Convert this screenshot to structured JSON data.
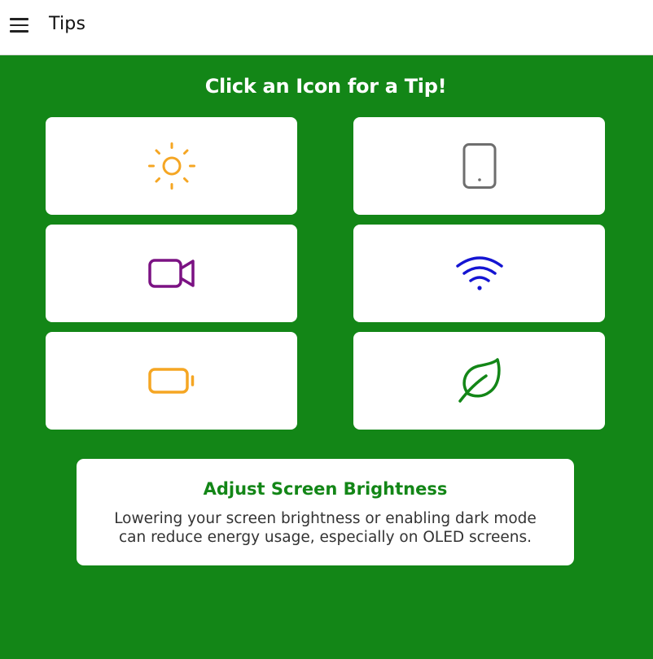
{
  "app_bar": {
    "title": "Tips",
    "menu_icon": "hamburger-menu-icon"
  },
  "heading": "Click an Icon for a Tip!",
  "tiles": [
    {
      "icon": "sun-icon",
      "color": "#F5A623"
    },
    {
      "icon": "phone-icon",
      "color": "#6E6E6E"
    },
    {
      "icon": "video-camera-icon",
      "color": "#7B1283"
    },
    {
      "icon": "wifi-icon",
      "color": "#1414D2"
    },
    {
      "icon": "battery-icon",
      "color": "#F5A623"
    },
    {
      "icon": "leaf-icon",
      "color": "#138617"
    }
  ],
  "tip": {
    "title": "Adjust Screen Brightness",
    "body": "Lowering your screen brightness or enabling dark mode can reduce energy usage, especially on OLED screens."
  },
  "colors": {
    "background": "#138617",
    "card": "#FFFFFF",
    "tip_title": "#138617"
  }
}
